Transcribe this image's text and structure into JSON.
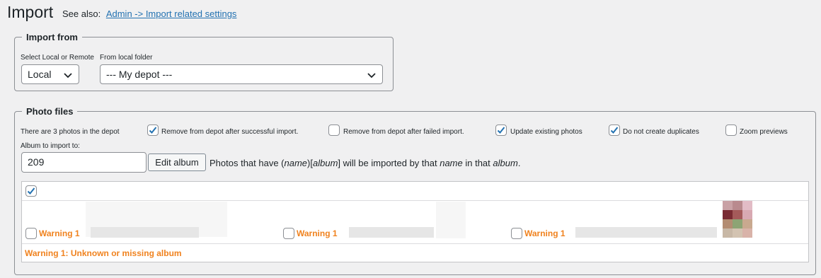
{
  "page": {
    "title": "Import",
    "see_also_label": "See also:",
    "see_also_link": "Admin -> Import related settings"
  },
  "import_from": {
    "legend": "Import from",
    "select_label": "Select Local or Remote",
    "select_value": "Local",
    "folder_label": "From local folder",
    "folder_value": "--- My depot ---"
  },
  "photo_files": {
    "legend": "Photo files",
    "count_text": "There are 3 photos in the depot",
    "options": [
      {
        "label": "Remove from depot after successful import.",
        "checked": true
      },
      {
        "label": "Remove from depot after failed import.",
        "checked": false
      },
      {
        "label": "Update existing photos",
        "checked": true
      },
      {
        "label": "Do not create duplicates",
        "checked": true
      },
      {
        "label": "Zoom previews",
        "checked": false
      }
    ],
    "album_label": "Album to import to:",
    "album_value": "209",
    "edit_album_button": "Edit album",
    "hint_pre": "Photos that have (",
    "hint_name": "name",
    "hint_mid": ")[",
    "hint_album": "album",
    "hint_post1": "] will be imported by that ",
    "hint_name2": "name",
    "hint_post2": " in that ",
    "hint_album2": "album",
    "hint_end": "."
  },
  "photos": [
    {
      "warning": "Warning 1",
      "checked": false
    },
    {
      "warning": "Warning 1",
      "checked": false
    },
    {
      "warning": "Warning 1",
      "checked": false
    }
  ],
  "footer_warning": "Warning 1: Unknown or missing album",
  "colors": {
    "accent": "#2271b1",
    "warning": "#f0821e",
    "background": "#f0f0f1"
  }
}
